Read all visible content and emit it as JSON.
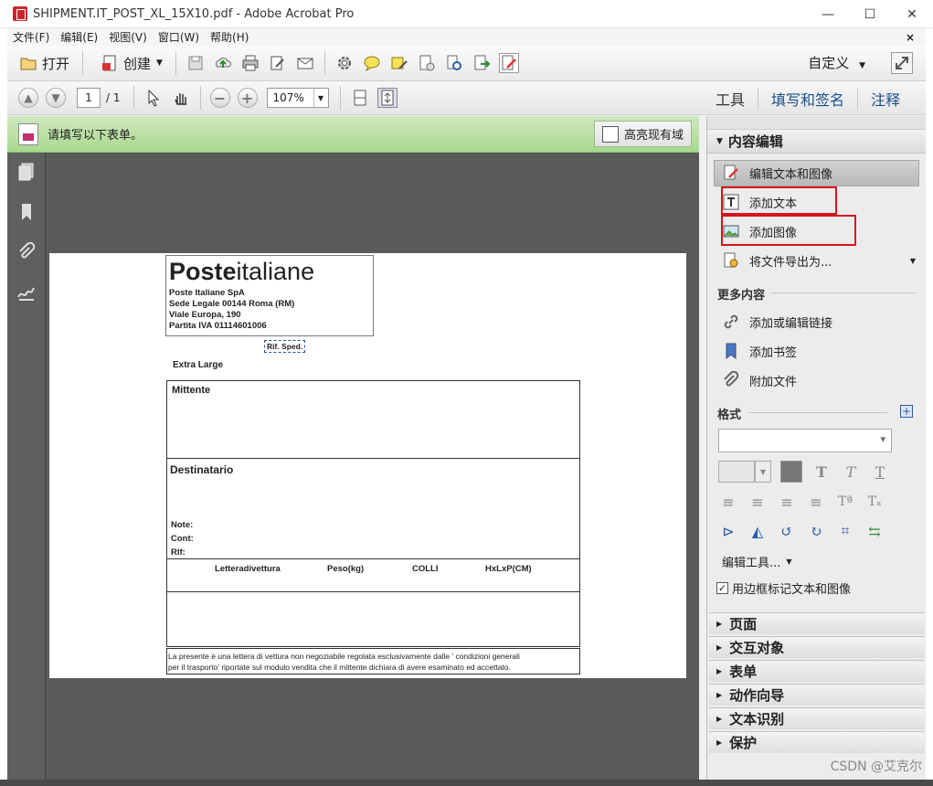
{
  "window": {
    "title": "SHIPMENT.IT_POST_XL_15X10.pdf - Adobe Acrobat Pro",
    "min": "—",
    "max": "☐",
    "close": "✕"
  },
  "menu": {
    "items": [
      "文件(F)",
      "编辑(E)",
      "视图(V)",
      "窗口(W)",
      "帮助(H)"
    ],
    "close": "×"
  },
  "toolbar": {
    "open": "打开",
    "create": "创建",
    "custom": "自定义"
  },
  "nav": {
    "page": "1",
    "total": "/ 1",
    "zoom": "107%"
  },
  "tabs": {
    "tools": "工具",
    "fill_sign": "填写和签名",
    "comment": "注释"
  },
  "form_bar": {
    "message": "请填写以下表单。",
    "highlight": "高亮现有域"
  },
  "document": {
    "logo_bold": "Poste",
    "logo_light": "italiane",
    "address": [
      "Poste Italiane SpA",
      "Sede Legale 00144 Roma (RM)",
      "Viale Europa, 190",
      "Partita IVA 01114601006"
    ],
    "rif": "Rif. Sped.",
    "size_label": "Extra Large",
    "mittente": "Mittente",
    "destinatario": "Destinatario",
    "note": "Note:",
    "cont": "Cont:",
    "rlf": "Rlf:",
    "col1": "Letteradivettura",
    "col2": "Peso(kg)",
    "col3": "COLLI",
    "col4": "HxLxP(CM)",
    "footer1": "La presente è una lettera di vettura non negoziabile regolata esclusivamente dalle ' condizioni generali",
    "footer2": "per il trasporto' riportate sul modulo vendita che il mittente dichiara di avere esaminato ed accettato."
  },
  "panel": {
    "content_edit": "内容编辑",
    "edit_text_image": "编辑文本和图像",
    "add_text": "添加文本",
    "add_image": "添加图像",
    "export_as": "将文件导出为...",
    "more_content": "更多内容",
    "add_link": "添加或编辑链接",
    "add_bookmark": "添加书签",
    "attach_file": "附加文件",
    "format": "格式",
    "edit_tools": "编辑工具...",
    "border_label": "用边框标记文本和图像",
    "sections": [
      "页面",
      "交互对象",
      "表单",
      "动作向导",
      "文本识别",
      "保护"
    ]
  },
  "watermark": "CSDN @艾克尔"
}
